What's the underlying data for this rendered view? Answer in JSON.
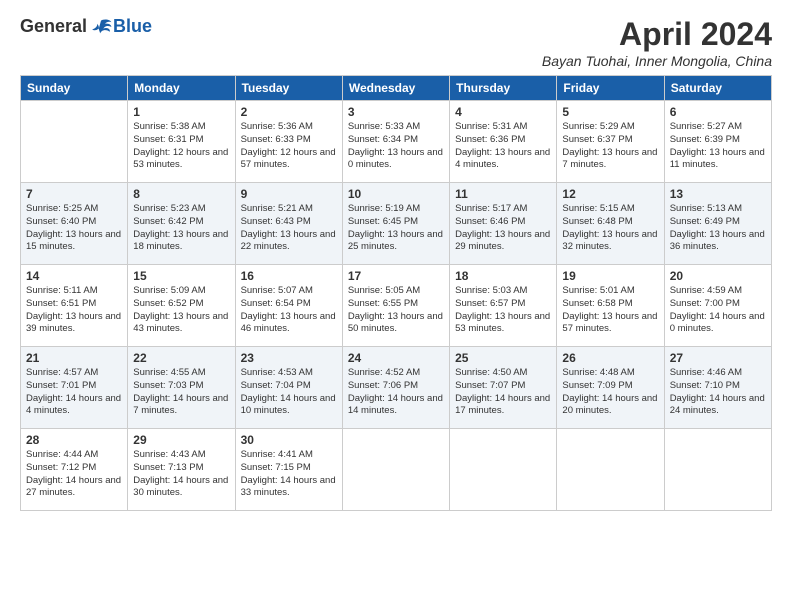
{
  "header": {
    "logo": {
      "general": "General",
      "blue": "Blue"
    },
    "title": "April 2024",
    "location": "Bayan Tuohai, Inner Mongolia, China"
  },
  "days_of_week": [
    "Sunday",
    "Monday",
    "Tuesday",
    "Wednesday",
    "Thursday",
    "Friday",
    "Saturday"
  ],
  "weeks": [
    [
      {
        "day": "",
        "empty": true
      },
      {
        "day": "1",
        "sunrise": "Sunrise: 5:38 AM",
        "sunset": "Sunset: 6:31 PM",
        "daylight": "Daylight: 12 hours and 53 minutes."
      },
      {
        "day": "2",
        "sunrise": "Sunrise: 5:36 AM",
        "sunset": "Sunset: 6:33 PM",
        "daylight": "Daylight: 12 hours and 57 minutes."
      },
      {
        "day": "3",
        "sunrise": "Sunrise: 5:33 AM",
        "sunset": "Sunset: 6:34 PM",
        "daylight": "Daylight: 13 hours and 0 minutes."
      },
      {
        "day": "4",
        "sunrise": "Sunrise: 5:31 AM",
        "sunset": "Sunset: 6:36 PM",
        "daylight": "Daylight: 13 hours and 4 minutes."
      },
      {
        "day": "5",
        "sunrise": "Sunrise: 5:29 AM",
        "sunset": "Sunset: 6:37 PM",
        "daylight": "Daylight: 13 hours and 7 minutes."
      },
      {
        "day": "6",
        "sunrise": "Sunrise: 5:27 AM",
        "sunset": "Sunset: 6:39 PM",
        "daylight": "Daylight: 13 hours and 11 minutes."
      }
    ],
    [
      {
        "day": "7",
        "sunrise": "Sunrise: 5:25 AM",
        "sunset": "Sunset: 6:40 PM",
        "daylight": "Daylight: 13 hours and 15 minutes."
      },
      {
        "day": "8",
        "sunrise": "Sunrise: 5:23 AM",
        "sunset": "Sunset: 6:42 PM",
        "daylight": "Daylight: 13 hours and 18 minutes."
      },
      {
        "day": "9",
        "sunrise": "Sunrise: 5:21 AM",
        "sunset": "Sunset: 6:43 PM",
        "daylight": "Daylight: 13 hours and 22 minutes."
      },
      {
        "day": "10",
        "sunrise": "Sunrise: 5:19 AM",
        "sunset": "Sunset: 6:45 PM",
        "daylight": "Daylight: 13 hours and 25 minutes."
      },
      {
        "day": "11",
        "sunrise": "Sunrise: 5:17 AM",
        "sunset": "Sunset: 6:46 PM",
        "daylight": "Daylight: 13 hours and 29 minutes."
      },
      {
        "day": "12",
        "sunrise": "Sunrise: 5:15 AM",
        "sunset": "Sunset: 6:48 PM",
        "daylight": "Daylight: 13 hours and 32 minutes."
      },
      {
        "day": "13",
        "sunrise": "Sunrise: 5:13 AM",
        "sunset": "Sunset: 6:49 PM",
        "daylight": "Daylight: 13 hours and 36 minutes."
      }
    ],
    [
      {
        "day": "14",
        "sunrise": "Sunrise: 5:11 AM",
        "sunset": "Sunset: 6:51 PM",
        "daylight": "Daylight: 13 hours and 39 minutes."
      },
      {
        "day": "15",
        "sunrise": "Sunrise: 5:09 AM",
        "sunset": "Sunset: 6:52 PM",
        "daylight": "Daylight: 13 hours and 43 minutes."
      },
      {
        "day": "16",
        "sunrise": "Sunrise: 5:07 AM",
        "sunset": "Sunset: 6:54 PM",
        "daylight": "Daylight: 13 hours and 46 minutes."
      },
      {
        "day": "17",
        "sunrise": "Sunrise: 5:05 AM",
        "sunset": "Sunset: 6:55 PM",
        "daylight": "Daylight: 13 hours and 50 minutes."
      },
      {
        "day": "18",
        "sunrise": "Sunrise: 5:03 AM",
        "sunset": "Sunset: 6:57 PM",
        "daylight": "Daylight: 13 hours and 53 minutes."
      },
      {
        "day": "19",
        "sunrise": "Sunrise: 5:01 AM",
        "sunset": "Sunset: 6:58 PM",
        "daylight": "Daylight: 13 hours and 57 minutes."
      },
      {
        "day": "20",
        "sunrise": "Sunrise: 4:59 AM",
        "sunset": "Sunset: 7:00 PM",
        "daylight": "Daylight: 14 hours and 0 minutes."
      }
    ],
    [
      {
        "day": "21",
        "sunrise": "Sunrise: 4:57 AM",
        "sunset": "Sunset: 7:01 PM",
        "daylight": "Daylight: 14 hours and 4 minutes."
      },
      {
        "day": "22",
        "sunrise": "Sunrise: 4:55 AM",
        "sunset": "Sunset: 7:03 PM",
        "daylight": "Daylight: 14 hours and 7 minutes."
      },
      {
        "day": "23",
        "sunrise": "Sunrise: 4:53 AM",
        "sunset": "Sunset: 7:04 PM",
        "daylight": "Daylight: 14 hours and 10 minutes."
      },
      {
        "day": "24",
        "sunrise": "Sunrise: 4:52 AM",
        "sunset": "Sunset: 7:06 PM",
        "daylight": "Daylight: 14 hours and 14 minutes."
      },
      {
        "day": "25",
        "sunrise": "Sunrise: 4:50 AM",
        "sunset": "Sunset: 7:07 PM",
        "daylight": "Daylight: 14 hours and 17 minutes."
      },
      {
        "day": "26",
        "sunrise": "Sunrise: 4:48 AM",
        "sunset": "Sunset: 7:09 PM",
        "daylight": "Daylight: 14 hours and 20 minutes."
      },
      {
        "day": "27",
        "sunrise": "Sunrise: 4:46 AM",
        "sunset": "Sunset: 7:10 PM",
        "daylight": "Daylight: 14 hours and 24 minutes."
      }
    ],
    [
      {
        "day": "28",
        "sunrise": "Sunrise: 4:44 AM",
        "sunset": "Sunset: 7:12 PM",
        "daylight": "Daylight: 14 hours and 27 minutes."
      },
      {
        "day": "29",
        "sunrise": "Sunrise: 4:43 AM",
        "sunset": "Sunset: 7:13 PM",
        "daylight": "Daylight: 14 hours and 30 minutes."
      },
      {
        "day": "30",
        "sunrise": "Sunrise: 4:41 AM",
        "sunset": "Sunset: 7:15 PM",
        "daylight": "Daylight: 14 hours and 33 minutes."
      },
      {
        "day": "",
        "empty": true
      },
      {
        "day": "",
        "empty": true
      },
      {
        "day": "",
        "empty": true
      },
      {
        "day": "",
        "empty": true
      }
    ]
  ]
}
